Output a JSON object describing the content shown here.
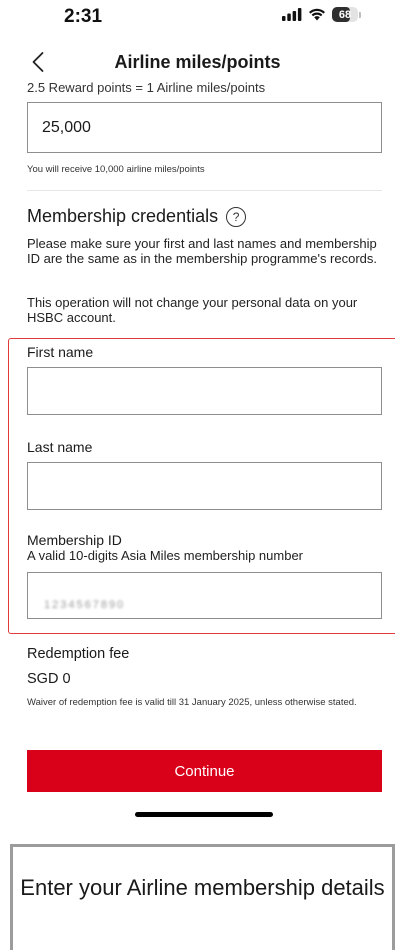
{
  "status_bar": {
    "time": "2:31",
    "battery_level": 68,
    "icons": [
      "signal-icon",
      "wifi-icon",
      "battery-icon"
    ]
  },
  "nav": {
    "back_icon": "chevron-left-icon",
    "title": "Airline miles/points"
  },
  "conversion": {
    "rate_text": "2.5 Reward points = 1 Airline miles/points",
    "points_value": "25,000",
    "receive_text": "You will receive 10,000 airline miles/points"
  },
  "credentials": {
    "title": "Membership credentials",
    "help_icon": "question-circle-icon",
    "help_glyph": "?",
    "description": "Please make sure your first and last names and membership ID are the same as in the membership programme's records.",
    "notice": "This operation will not change your personal data on your HSBC account."
  },
  "form": {
    "first_name_label": "First name",
    "first_name_value": "",
    "last_name_label": "Last name",
    "last_name_value": "",
    "membership_id_label": "Membership ID",
    "membership_id_hint": "A valid 10-digits Asia Miles membership number",
    "membership_id_placeholder": "1234567890"
  },
  "fee": {
    "label": "Redemption fee",
    "value": "SGD 0",
    "waiver": "Waiver of redemption fee is valid till 31 January 2025, unless otherwise stated."
  },
  "actions": {
    "continue_label": "Continue"
  },
  "caption": {
    "text": "Enter your Airline membership details"
  },
  "colors": {
    "primary_button": "#d9001a",
    "highlight_border": "#e03a3a"
  }
}
